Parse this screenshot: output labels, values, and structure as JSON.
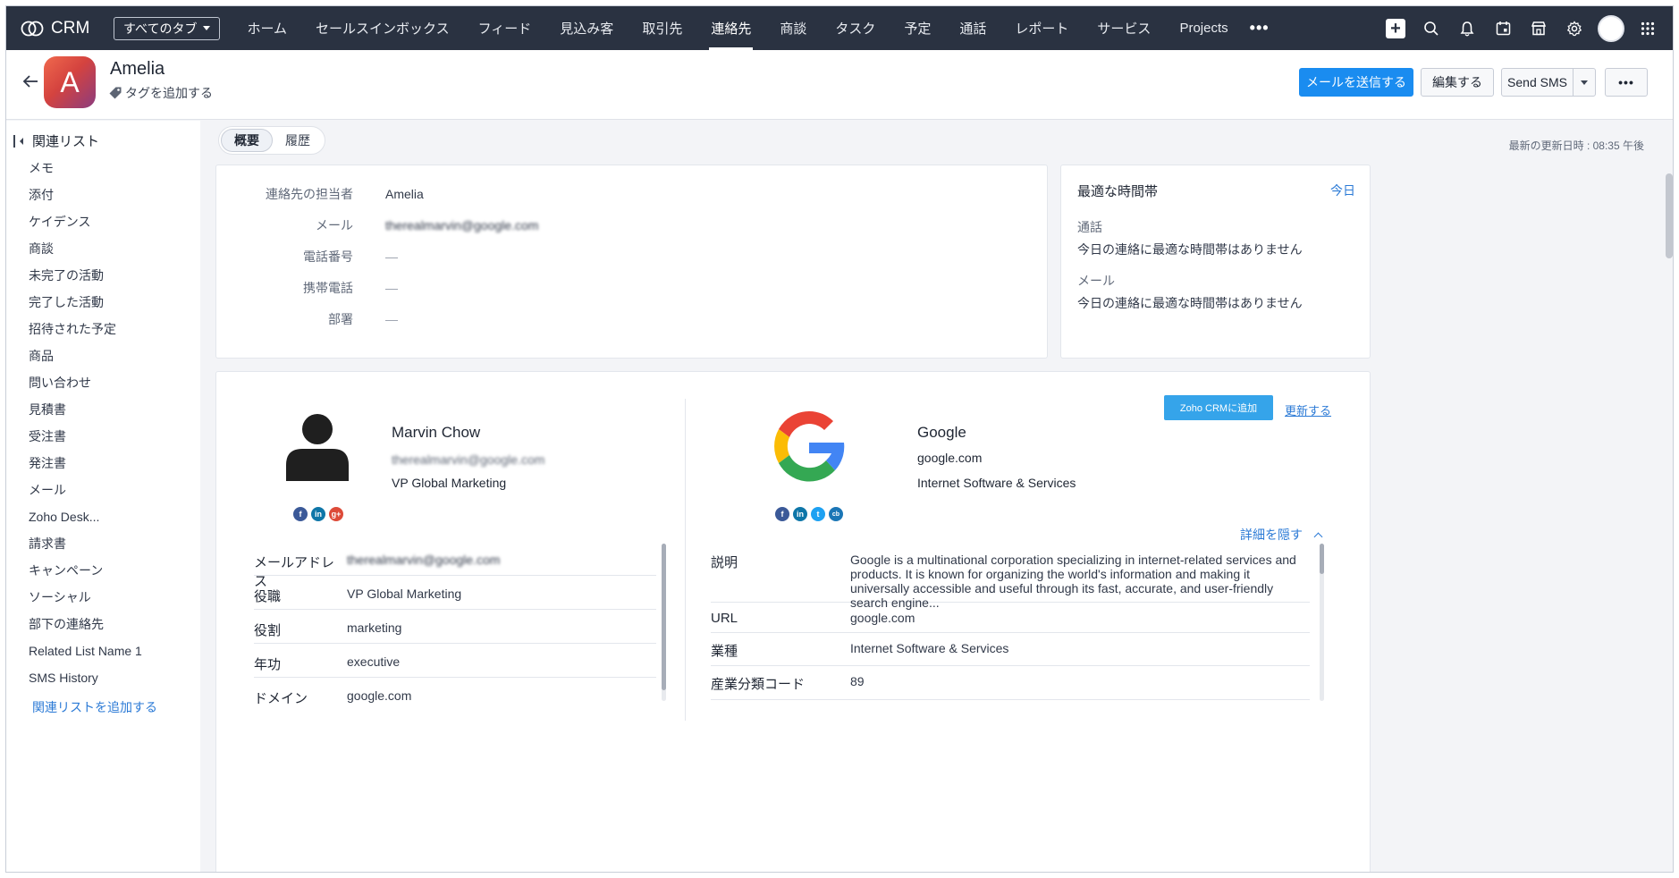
{
  "nav": {
    "brand": "CRM",
    "all_tabs": "すべてのタブ",
    "items": [
      "ホーム",
      "セールスインボックス",
      "フィード",
      "見込み客",
      "取引先",
      "連絡先",
      "商談",
      "タスク",
      "予定",
      "通話",
      "レポート",
      "サービス",
      "Projects"
    ],
    "active_item": "連絡先",
    "more": "•••"
  },
  "record": {
    "avatar_letter": "A",
    "name": "Amelia",
    "add_tag": "タグを追加する",
    "buttons": {
      "send_email": "メールを送信する",
      "edit": "編集する",
      "send_sms": "Send SMS",
      "more": "•••"
    }
  },
  "sidebar": {
    "title": "関連リスト",
    "items": [
      "メモ",
      "添付",
      "ケイデンス",
      "商談",
      "未完了の活動",
      "完了した活動",
      "招待された予定",
      "商品",
      "問い合わせ",
      "見積書",
      "受注書",
      "発注書",
      "メール",
      "Zoho Desk...",
      "請求書",
      "キャンペーン",
      "ソーシャル",
      "部下の連絡先",
      "Related List Name 1",
      "SMS History"
    ],
    "add_link": "関連リストを追加する"
  },
  "tabs": {
    "overview": "概要",
    "history": "履歴"
  },
  "last_updated": "最新の更新日時 : 08:35 午後",
  "summary": {
    "owner_label": "連絡先の担当者",
    "owner_value": "Amelia",
    "email_label": "メール",
    "email_value": "therealmarvin@google.com",
    "phone_label": "電話番号",
    "phone_value": "—",
    "mobile_label": "携帯電話",
    "mobile_value": "—",
    "dept_label": "部署",
    "dept_value": "—"
  },
  "best_time": {
    "title": "最適な時間帯",
    "today_link": "今日",
    "call_label": "通話",
    "call_msg": "今日の連絡に最適な時間帯はありません",
    "email_label": "メール",
    "email_msg": "今日の連絡に最適な時間帯はありません"
  },
  "person": {
    "name": "Marvin Chow",
    "email": "therealmarvin@google.com",
    "title": "VP Global Marketing",
    "details": [
      {
        "key": "メールアドレス",
        "value": "therealmarvin@google.com"
      },
      {
        "key": "役職",
        "value": "VP Global Marketing"
      },
      {
        "key": "役割",
        "value": "marketing"
      },
      {
        "key": "年功",
        "value": "executive"
      },
      {
        "key": "ドメイン",
        "value": "google.com"
      }
    ]
  },
  "company": {
    "name": "Google",
    "domain": "google.com",
    "industry": "Internet Software & Services",
    "add_button": "Zoho CRMに追加",
    "refresh_link": "更新する",
    "hide_details": "詳細を隠す",
    "details": [
      {
        "key": "説明",
        "value": "Google is a multinational corporation specializing in internet-related services and products. It is known for organizing the world's information and making it universally accessible and useful through its fast, accurate, and user-friendly search engine..."
      },
      {
        "key": "URL",
        "value": "google.com"
      },
      {
        "key": "業種",
        "value": "Internet Software & Services"
      },
      {
        "key": "産業分類コード",
        "value": "89"
      }
    ]
  },
  "social_icons": {
    "person": [
      "facebook-icon",
      "linkedin-icon",
      "google-plus-icon"
    ],
    "company": [
      "facebook-icon",
      "linkedin-icon",
      "twitter-icon",
      "crunchbase-icon"
    ]
  },
  "colors": {
    "nav_bg": "#2a3241",
    "primary": "#1a8cf0",
    "link": "#2b7ad6",
    "zoho_btn": "#35a4ea"
  }
}
